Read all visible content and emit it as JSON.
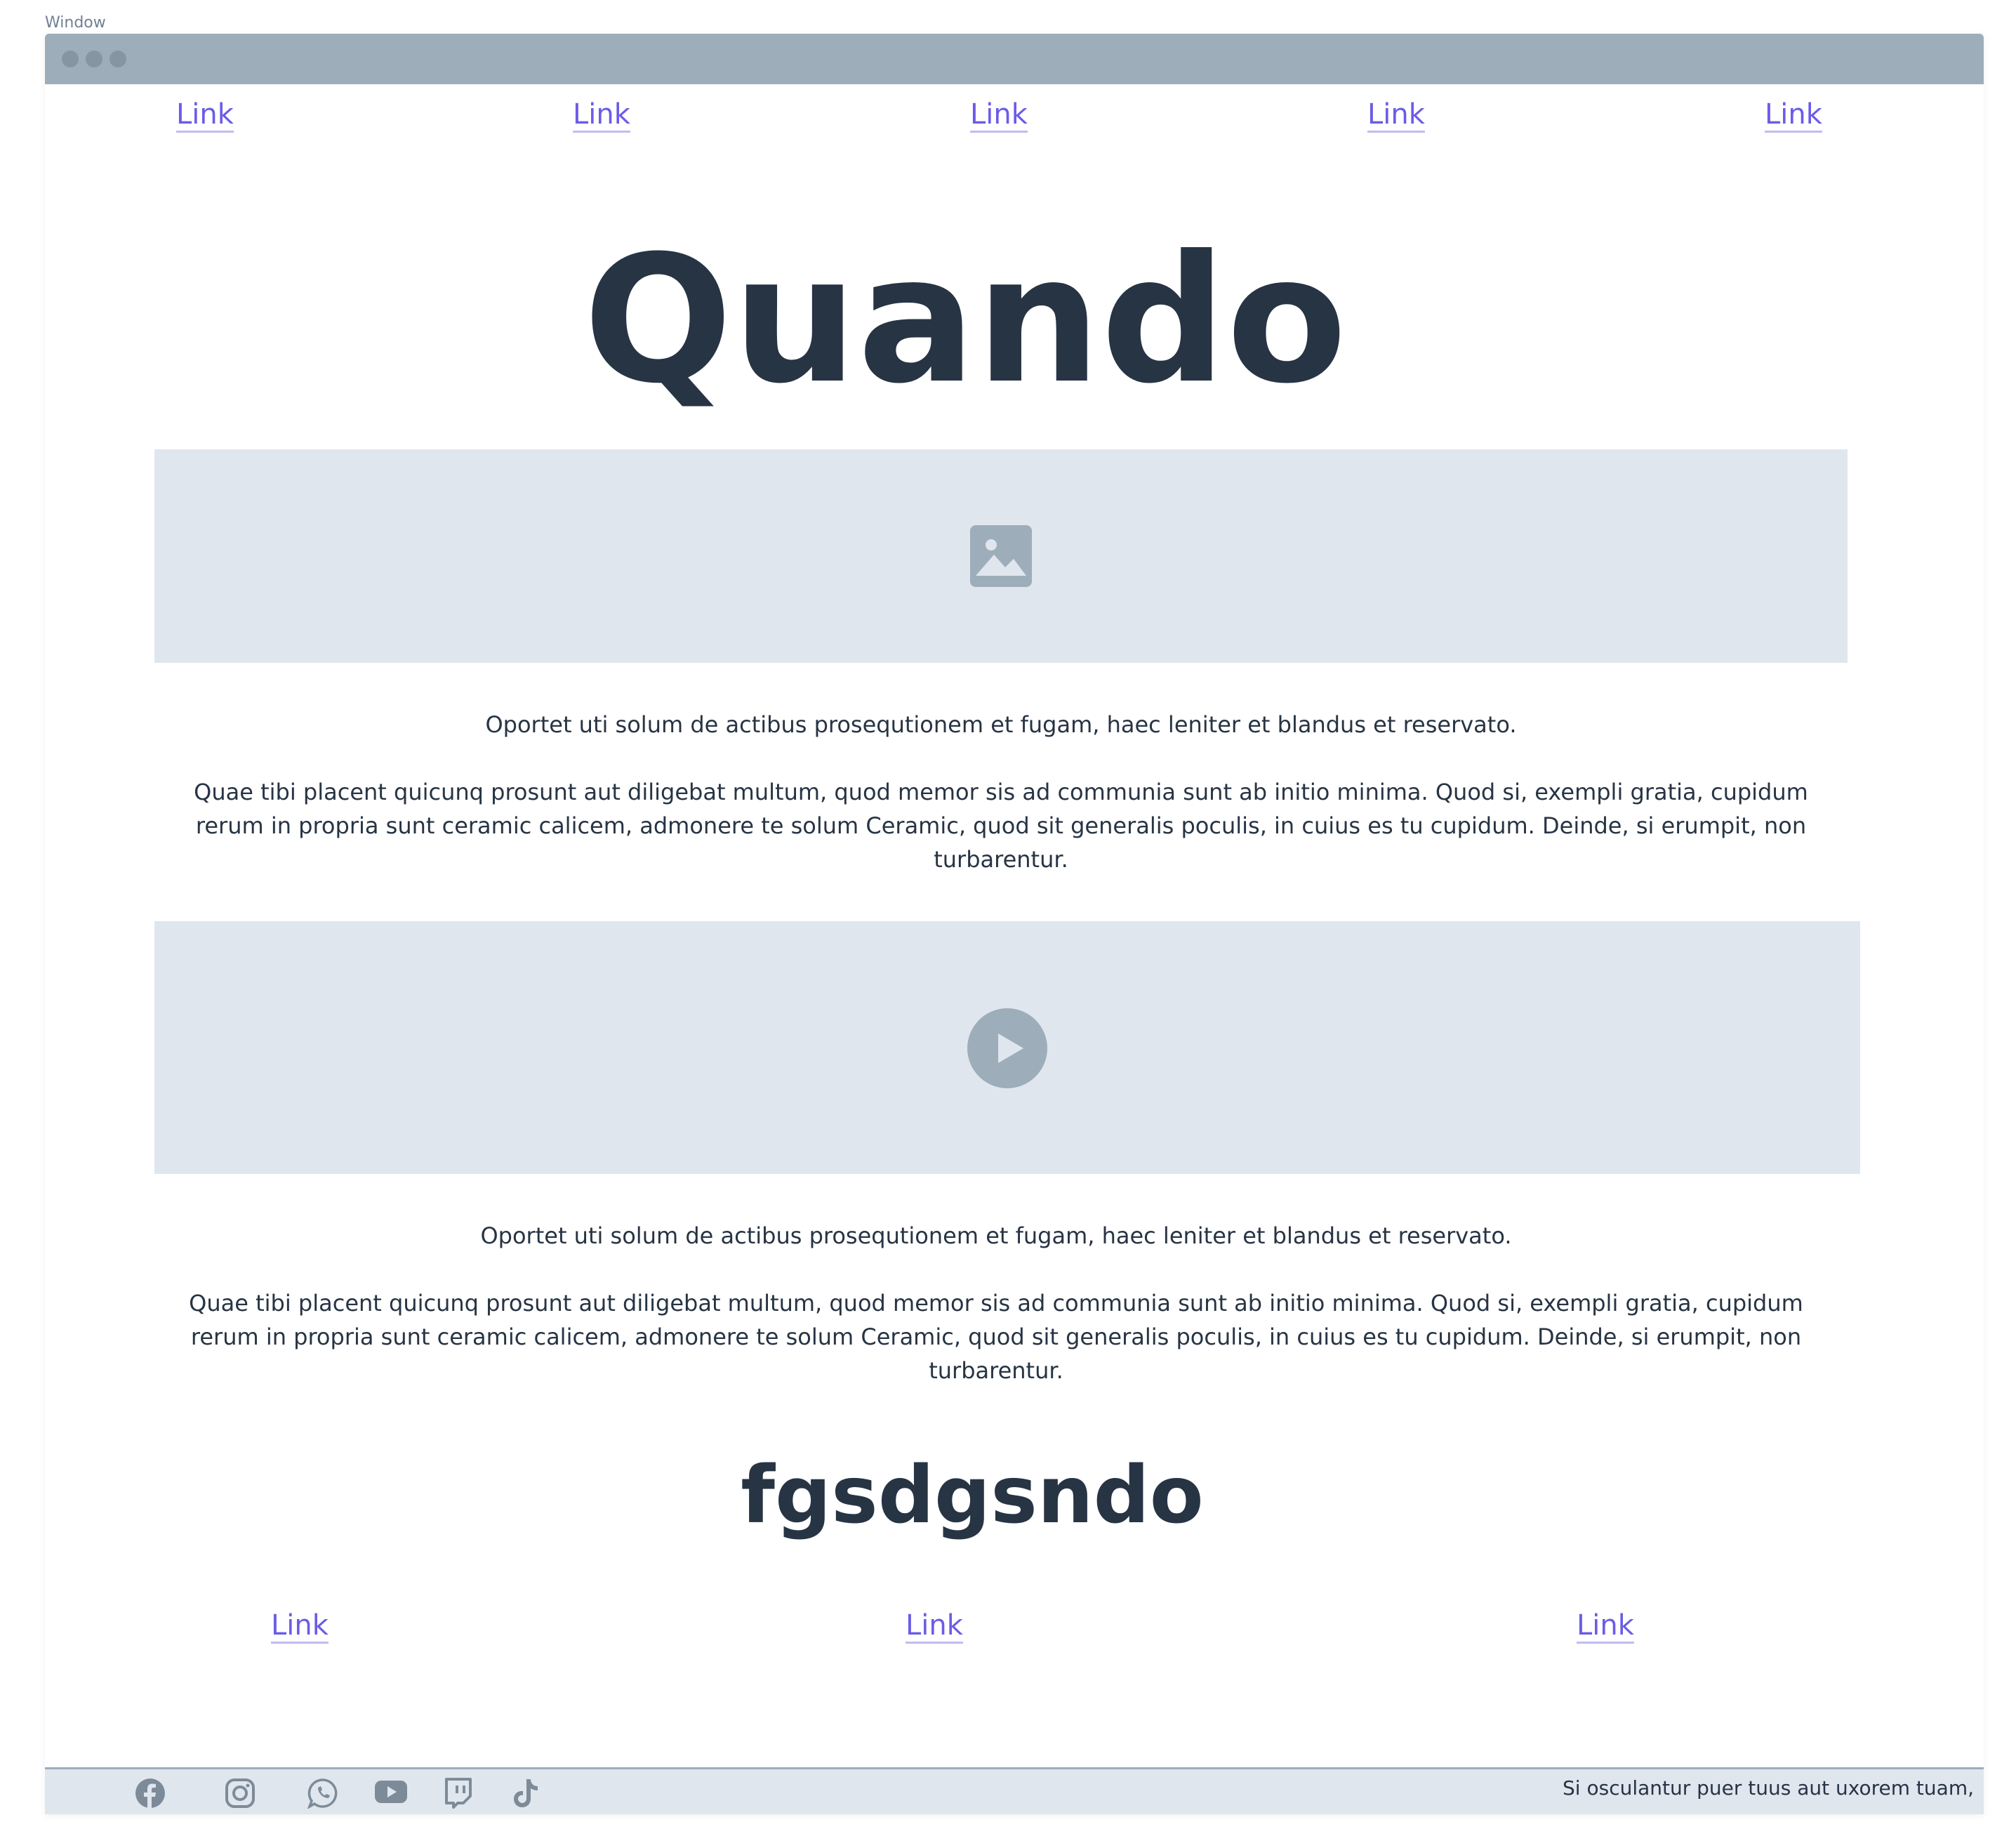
{
  "window": {
    "caption": "Window"
  },
  "nav": {
    "links": [
      "Link",
      "Link",
      "Link",
      "Link",
      "Link"
    ]
  },
  "hero": {
    "title": "Quando"
  },
  "section1": {
    "media_icon": "image-icon",
    "lead": "Oportet uti solum de actibus prosequtionem et fugam, haec leniter et blandus et reservato.",
    "body": "Quae tibi placent quicunq prosunt aut diligebat multum, quod memor sis ad communia sunt ab initio minima. Quod si, exempli gratia, cupidum rerum in propria sunt ceramic calicem, admonere te solum Ceramic, quod sit generalis poculis, in cuius es tu cupidum. Deinde, si erumpit, non turbarentur."
  },
  "section2": {
    "media_icon": "play-icon",
    "lead": "Oportet uti solum de actibus prosequtionem et fugam, haec leniter et blandus et reservato.",
    "body": "Quae tibi placent quicunq prosunt aut diligebat multum, quod memor sis ad communia sunt ab initio minima. Quod si, exempli gratia, cupidum rerum in propria sunt ceramic calicem, admonere te solum Ceramic, quod sit generalis poculis, in cuius es tu cupidum. Deinde, si erumpit, non turbarentur."
  },
  "subheading": {
    "title": "fgsdgsndo"
  },
  "bottom_links": [
    "Link",
    "Link",
    "Link"
  ],
  "footer": {
    "social_icons": [
      "facebook-icon",
      "instagram-icon",
      "whatsapp-icon",
      "youtube-icon",
      "twitch-icon",
      "tiktok-icon"
    ],
    "text": "Si osculantur puer tuus aut uxorem tuam,"
  },
  "colors": {
    "link": "#6b5ce7",
    "text": "#273444",
    "placeholder_bg": "#e0e6ee",
    "icon": "#9eadba",
    "titlebar": "#9eadba"
  }
}
